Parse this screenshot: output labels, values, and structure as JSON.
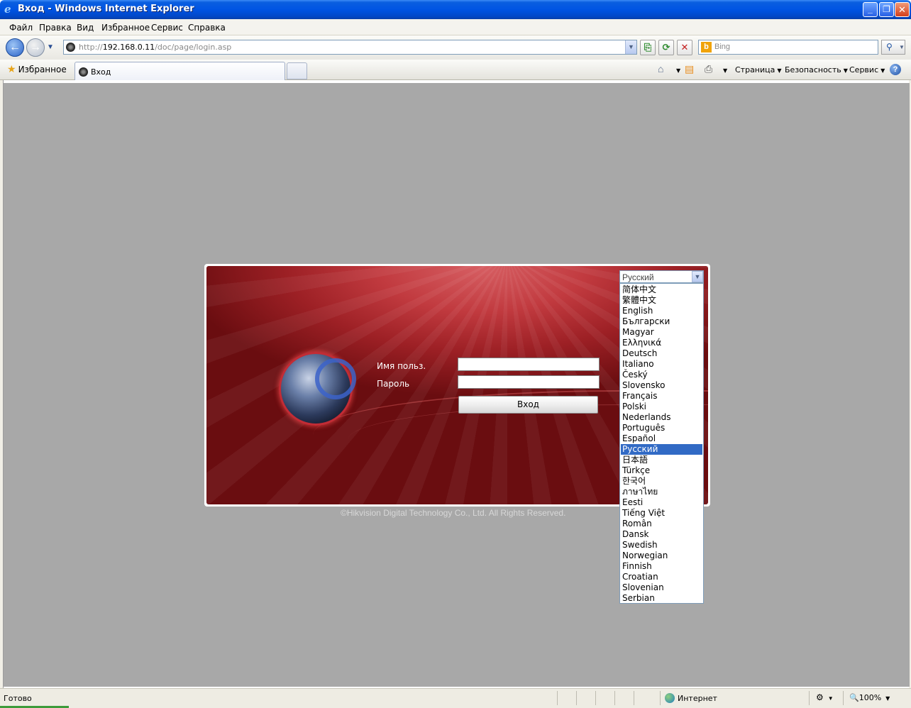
{
  "window": {
    "title": "Вход - Windows Internet Explorer"
  },
  "menu": [
    "Файл",
    "Правка",
    "Вид",
    "Избранное",
    "Сервис",
    "Справка"
  ],
  "address": {
    "prefix": "http://",
    "host": "192.168.0.11",
    "path": "/doc/page/login.asp"
  },
  "search": {
    "placeholder": "Bing"
  },
  "favorites_label": "Избранное",
  "tab": {
    "label": "Вход"
  },
  "commands": {
    "page": "Страница",
    "safety": "Безопасность",
    "tools": "Сервис"
  },
  "login": {
    "username_label": "Имя польз.",
    "password_label": "Пароль",
    "username_value": "",
    "password_value": "",
    "submit_label": "Вход",
    "copyright": "©Hikvision Digital Technology Co., Ltd. All Rights Reserved."
  },
  "language": {
    "selected": "Русский",
    "options": [
      "简体中文",
      "繁體中文",
      "English",
      "Български",
      "Magyar",
      "Ελληνικά",
      "Deutsch",
      "Italiano",
      "Český",
      "Slovensko",
      "Français",
      "Polski",
      "Nederlands",
      "Português",
      "Español",
      "Русский",
      "日本語",
      "Türkçe",
      "한국어",
      "ภาษาไทย",
      "Eesti",
      "Tiếng Việt",
      "Român",
      "Dansk",
      "Swedish",
      "Norwegian",
      "Finnish",
      "Croatian",
      "Slovenian",
      "Serbian"
    ]
  },
  "status": {
    "text": "Готово",
    "zone": "Интернет",
    "zoom": "100%"
  },
  "colors": {
    "panel_red": "#b5262d",
    "selection": "#316ac5",
    "page_bg": "#a8a8a8"
  }
}
